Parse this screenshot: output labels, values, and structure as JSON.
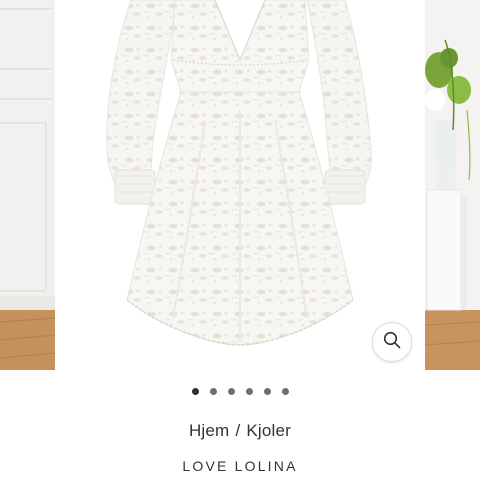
{
  "breadcrumb": {
    "home": "Hjem",
    "separator": "/",
    "current": "Kjoler"
  },
  "product": {
    "brand": "LOVE LOLINA"
  },
  "gallery": {
    "slide_count": 6,
    "active_index": 0,
    "zoom_icon": "search-icon"
  },
  "colors": {
    "text": "#333333",
    "dot": "#6f6f6f"
  }
}
